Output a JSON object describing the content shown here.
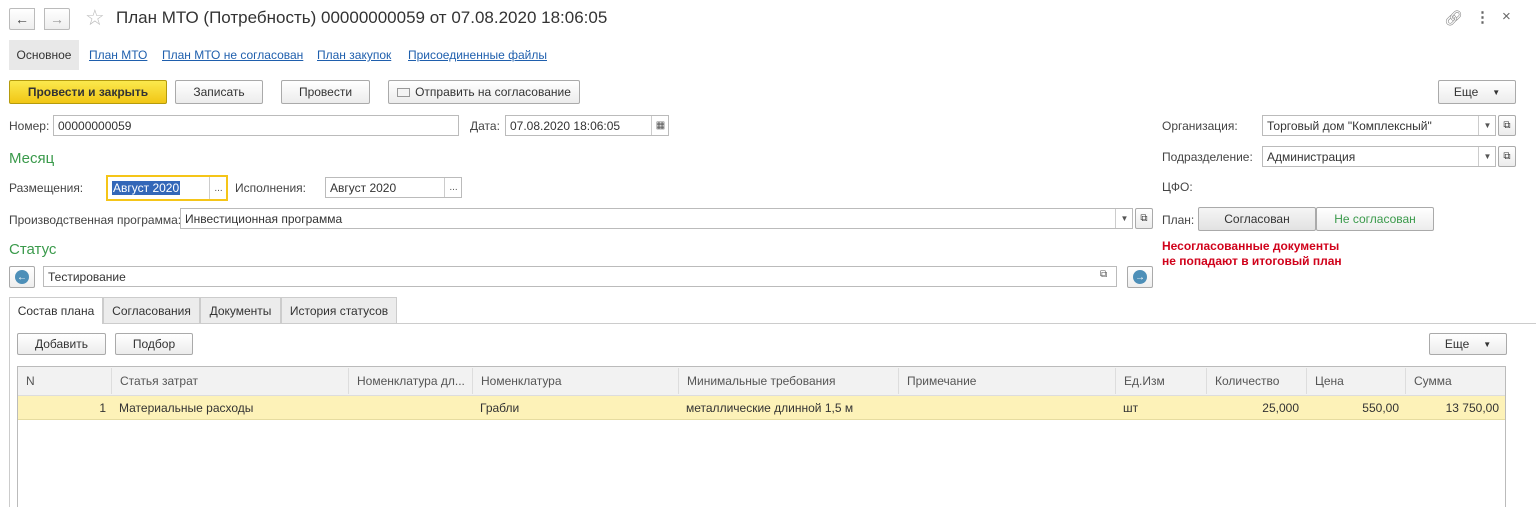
{
  "window": {
    "title": "План МТО (Потребность) 00000000059 от 07.08.2020 18:06:05"
  },
  "nav_links": {
    "main": "Основное",
    "plan_mto": "План МТО",
    "plan_mto_not_agreed": "План МТО не согласован",
    "purchase_plan": "План закупок",
    "attached_files": "Присоединенные файлы"
  },
  "toolbar": {
    "post_close": "Провести и закрыть",
    "save": "Записать",
    "post": "Провести",
    "send_for_approval": "Отправить на согласование",
    "more": "Еще"
  },
  "form": {
    "number_label": "Номер:",
    "number_value": "00000000059",
    "date_label": "Дата:",
    "date_value": "07.08.2020 18:06:05",
    "org_label": "Организация:",
    "org_value": "Торговый дом \"Комплексный\"",
    "dept_label": "Подразделение:",
    "dept_value": "Администрация",
    "cfo_label": "ЦФО:",
    "month_section": "Месяц",
    "placement_label": "Размещения:",
    "placement_value": "Август 2020",
    "execution_label": "Исполнения:",
    "execution_value": "Август 2020",
    "program_label": "Производственная программа:",
    "program_value": "Инвестиционная программа",
    "plan_label": "План:",
    "plan_agreed": "Согласован",
    "plan_not_agreed": "Не согласован",
    "status_section": "Статус",
    "status_value": "Тестирование",
    "warning_line1": "Несогласованные документы",
    "warning_line2": "не попадают в итоговый план"
  },
  "tabs": [
    "Состав плана",
    "Согласования",
    "Документы",
    "История статусов"
  ],
  "table_toolbar": {
    "add": "Добавить",
    "select": "Подбор",
    "more": "Еще"
  },
  "table": {
    "columns": [
      "N",
      "Статья затрат",
      "Номенклатура дл...",
      "Номенклатура",
      "Минимальные требования",
      "Примечание",
      "Ед.Изм",
      "Количество",
      "Цена",
      "Сумма"
    ],
    "rows": [
      {
        "n": "1",
        "cost_item": "Материальные расходы",
        "nom_for": "",
        "nomenclature": "Грабли",
        "min_req": "металлические длинной 1,5 м",
        "note": "",
        "unit": "шт",
        "qty": "25,000",
        "price": "550,00",
        "sum": "13 750,00"
      }
    ]
  },
  "colors": {
    "accent_green": "#3a9a4b",
    "warning_red": "#d0021b",
    "selected_row": "#fdf2b8",
    "link_blue": "#1f5fad"
  }
}
